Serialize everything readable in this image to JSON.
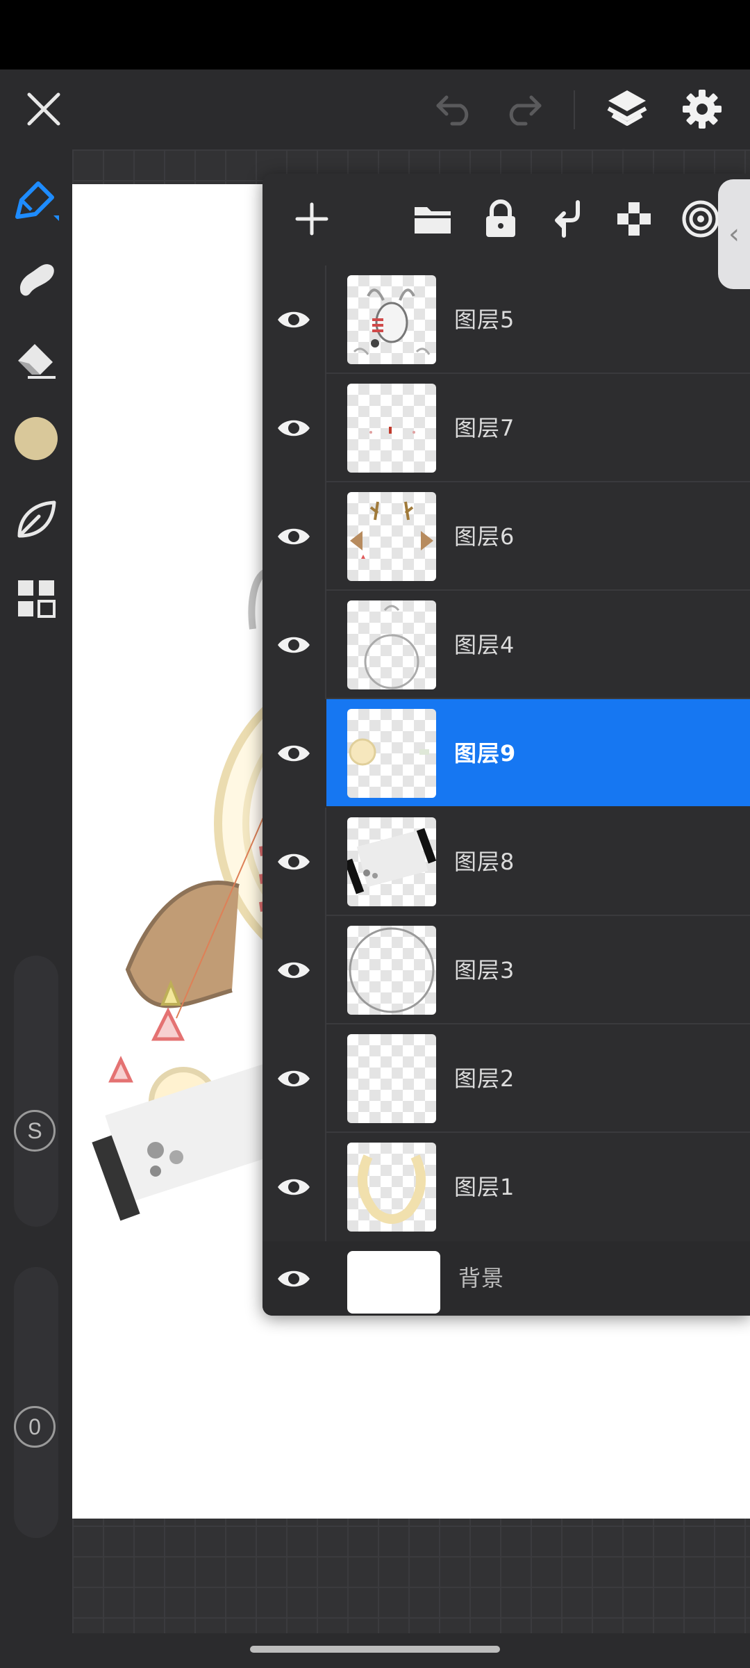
{
  "app": {
    "icons": {
      "close": "close-icon",
      "undo": "undo-icon",
      "redo": "redo-icon",
      "layers": "layers-icon",
      "settings": "gear-icon"
    }
  },
  "tools": [
    {
      "name": "pen-tool",
      "icon": "pen-icon",
      "active": true
    },
    {
      "name": "smudge-tool",
      "icon": "smudge-icon"
    },
    {
      "name": "eraser-tool",
      "icon": "eraser-icon"
    },
    {
      "name": "color-swatch",
      "icon": "color-swatch",
      "color": "#d9c89a"
    },
    {
      "name": "brush-library",
      "icon": "leaf-icon"
    },
    {
      "name": "gallery",
      "icon": "grid-icon"
    }
  ],
  "sliders": {
    "size_label": "S",
    "opacity_label": "0"
  },
  "layers_panel": {
    "toolbar_icons": [
      "add-icon",
      "folder-icon",
      "lock-icon",
      "merge-down-icon",
      "transparency-icon",
      "spiral-icon"
    ],
    "layers": [
      {
        "label": "图层5",
        "visible": true,
        "selected": false
      },
      {
        "label": "图层7",
        "visible": true,
        "selected": false
      },
      {
        "label": "图层6",
        "visible": true,
        "selected": false
      },
      {
        "label": "图层4",
        "visible": true,
        "selected": false
      },
      {
        "label": "图层9",
        "visible": true,
        "selected": true
      },
      {
        "label": "图层8",
        "visible": true,
        "selected": false
      },
      {
        "label": "图层3",
        "visible": true,
        "selected": false
      },
      {
        "label": "图层2",
        "visible": true,
        "selected": false
      },
      {
        "label": "图层1",
        "visible": true,
        "selected": false
      },
      {
        "label": "背景",
        "visible": true,
        "selected": false
      }
    ]
  },
  "colors": {
    "accent": "#1677f2",
    "panel": "#2d2d2f",
    "toolbar": "#2b2b2d"
  }
}
